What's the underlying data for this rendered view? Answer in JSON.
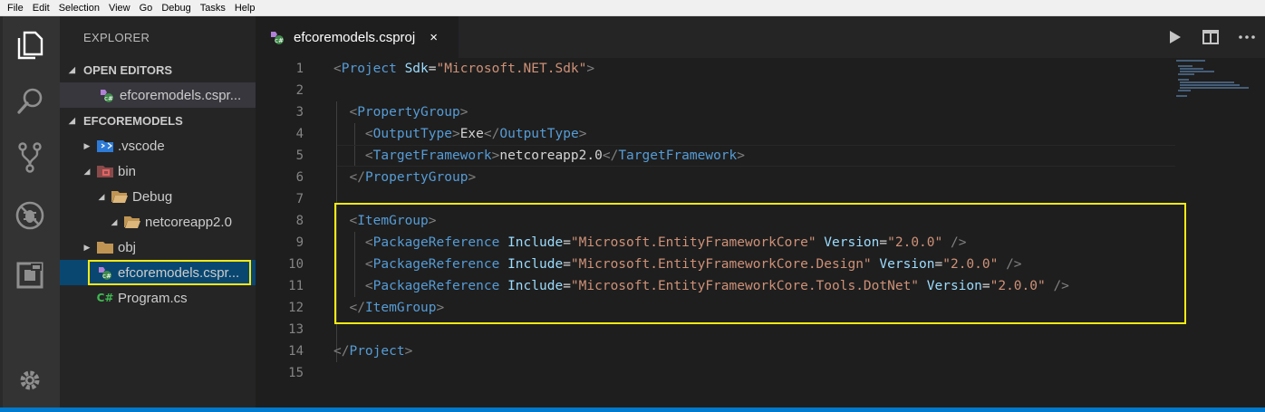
{
  "menu": [
    "File",
    "Edit",
    "Selection",
    "View",
    "Go",
    "Debug",
    "Tasks",
    "Help"
  ],
  "activity_bar": {
    "items": [
      "files-icon",
      "search-icon",
      "source-control-icon",
      "debug-icon",
      "extensions-icon"
    ],
    "bottom": "gear-icon"
  },
  "sidebar": {
    "title": "EXPLORER",
    "open_editors": {
      "header": "OPEN EDITORS",
      "items": [
        {
          "label": "efcoremodels.cspr...",
          "icon": "csproj-icon"
        }
      ]
    },
    "project": {
      "header": "EFCOREMODELS",
      "items": [
        {
          "label": ".vscode",
          "twisty": "▶",
          "icon": "vscode-folder-icon"
        },
        {
          "label": "bin",
          "twisty": "◢",
          "icon": "bin-folder-icon"
        },
        {
          "label": "Debug",
          "twisty": "◢",
          "icon": "folder-open-icon"
        },
        {
          "label": "netcoreapp2.0",
          "twisty": "◢",
          "icon": "folder-open-icon"
        },
        {
          "label": "obj",
          "twisty": "▶",
          "icon": "folder-icon"
        },
        {
          "label": "efcoremodels.cspr...",
          "twisty": "",
          "icon": "csproj-icon"
        },
        {
          "label": "Program.cs",
          "twisty": "",
          "icon": "csharp-icon",
          "icon_text": "C#"
        }
      ]
    }
  },
  "tab": {
    "label": "efcoremodels.csproj",
    "close": "×"
  },
  "editor_actions": [
    "run-icon",
    "split-editor-icon",
    "more-actions-icon"
  ],
  "editor": {
    "line_numbers": [
      "1",
      "2",
      "3",
      "4",
      "5",
      "6",
      "7",
      "8",
      "9",
      "10",
      "11",
      "12",
      "13",
      "14",
      "15"
    ],
    "code": {
      "l1": {
        "o": "<",
        "tag": "Project",
        "attr": "Sdk",
        "eq": "=",
        "val": "\"Microsoft.NET.Sdk\"",
        "c": ">"
      },
      "l3": {
        "o": "<",
        "tag": "PropertyGroup",
        "c": ">"
      },
      "l4": {
        "o": "<",
        "tag": "OutputType",
        "c": ">",
        "text": "Exe",
        "o2": "</",
        "tag2": "OutputType",
        "c2": ">"
      },
      "l5": {
        "o": "<",
        "tag": "TargetFramework",
        "c": ">",
        "text": "netcoreapp2.0",
        "o2": "</",
        "tag2": "TargetFramework",
        "c2": ">"
      },
      "l6": {
        "o": "</",
        "tag": "PropertyGroup",
        "c": ">"
      },
      "l8": {
        "o": "<",
        "tag": "ItemGroup",
        "c": ">"
      },
      "l9": {
        "o": "<",
        "tag": "PackageReference",
        "attr1": "Include",
        "eq": "=",
        "val1": "\"Microsoft.EntityFrameworkCore\"",
        "attr2": "Version",
        "val2": "\"2.0.0\"",
        "c": "/>"
      },
      "l10": {
        "o": "<",
        "tag": "PackageReference",
        "attr1": "Include",
        "eq": "=",
        "val1": "\"Microsoft.EntityFrameworkCore.Design\"",
        "attr2": "Version",
        "val2": "\"2.0.0\"",
        "c": "/>"
      },
      "l11": {
        "o": "<",
        "tag": "PackageReference",
        "attr1": "Include",
        "eq": "=",
        "val1": "\"Microsoft.EntityFrameworkCore.Tools.DotNet\"",
        "attr2": "Version",
        "val2": "\"2.0.0\"",
        "c": "/>"
      },
      "l12": {
        "o": "</",
        "tag": "ItemGroup",
        "c": ">"
      },
      "l14": {
        "o": "</",
        "tag": "Project",
        "c": ">"
      }
    }
  },
  "colors": {
    "highlight": "#f5ea14",
    "tag": "#569cd6",
    "attribute": "#9cdcfe",
    "string": "#ce9178",
    "selection": "#094771",
    "status_bar": "#007acc"
  }
}
